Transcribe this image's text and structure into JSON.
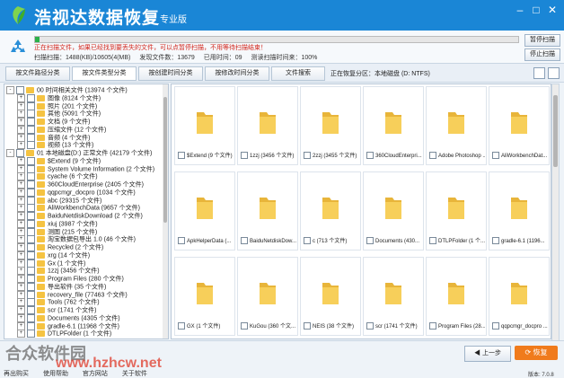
{
  "app": {
    "title": "浩视达数据恢复",
    "edition": "专业版",
    "colors": {
      "titlebar": "#1a86d6",
      "progress": "#2bb14a",
      "status_text": "#d2261c",
      "recover_button": "#f07b1c",
      "folder": "#f5c342"
    }
  },
  "window_controls": {
    "icons": [
      "minimize-icon",
      "maximize-icon",
      "close-icon"
    ]
  },
  "scan": {
    "progress": 0.01,
    "status": "正在扫描文件，如果已经找到要丢失的文件，可以点暂停扫描，不用等待扫描结束！",
    "stats": {
      "scanned": "扫描扫描：1488(KB)/10605(4(MB)",
      "found": "发现文件数：13679",
      "elapsed": "已用时间：09",
      "remaining": "测读扫描时间来：100%"
    },
    "pause_label": "暂停扫描",
    "stop_label": "停止扫描"
  },
  "tabs": [
    "按文件路径分类",
    "按文件类型分类",
    "按创建时间分类",
    "按修改时间分类",
    "文件搜索"
  ],
  "partition_label": "正在恢复分区：本地磁盘 (D: NTFS)",
  "tree": [
    {
      "label": "00 时间相关文件  (13974 个文件)",
      "level": 0,
      "expander": "-"
    },
    {
      "label": "图像  (8124 个文件)",
      "level": 1,
      "expander": "+"
    },
    {
      "label": "照片  (201 个文件)",
      "level": 1,
      "expander": "+"
    },
    {
      "label": "其他  (5091 个文件)",
      "level": 1,
      "expander": "+"
    },
    {
      "label": "文档  (9 个文件)",
      "level": 1,
      "expander": "+"
    },
    {
      "label": "压缩文件  (12 个文件)",
      "level": 1,
      "expander": "+"
    },
    {
      "label": "音频  (4 个文件)",
      "level": 1,
      "expander": "+"
    },
    {
      "label": "视频  (13 个文件)",
      "level": 1,
      "expander": "+"
    },
    {
      "label": "01 本地磁盘(D:) 正常文件  (42179 个文件)",
      "level": 0,
      "expander": "-"
    },
    {
      "label": "$Extend  (9 个文件)",
      "level": 1,
      "expander": "+"
    },
    {
      "label": "System Volume Information  (2 个文件)",
      "level": 1,
      "expander": "+"
    },
    {
      "label": "cyache  (6 个文件)",
      "level": 1,
      "expander": "+"
    },
    {
      "label": "360CloudEnterprise  (2405 个文件)",
      "level": 1,
      "expander": "+"
    },
    {
      "label": "qqpcmgr_docpro  (1034 个文件)",
      "level": 1,
      "expander": "+"
    },
    {
      "label": "abc  (29315 个文件)",
      "level": 1,
      "expander": "+"
    },
    {
      "label": "AliWorkbenchData  (9657 个文件)",
      "level": 1,
      "expander": "+"
    },
    {
      "label": "BaiduNetdiskDownload  (2 个文件)",
      "level": 1,
      "expander": "+"
    },
    {
      "label": "xiuj  (3987 个文件)",
      "level": 1,
      "expander": "+"
    },
    {
      "label": "测图  (215 个文件)",
      "level": 1,
      "expander": "+"
    },
    {
      "label": "淘宝数据包导出 1.0  (46 个文件)",
      "level": 1,
      "expander": "+"
    },
    {
      "label": "Recycled  (2 个文件)",
      "level": 1,
      "expander": "+"
    },
    {
      "label": "xrg  (14 个文件)",
      "level": 1,
      "expander": "+"
    },
    {
      "label": "Gx  (1 个文件)",
      "level": 1,
      "expander": "+"
    },
    {
      "label": "1zzj  (3456 个文件)",
      "level": 1,
      "expander": "+"
    },
    {
      "label": "Program Files  (280 个文件)",
      "level": 1,
      "expander": "+"
    },
    {
      "label": "导出软件  (35 个文件)",
      "level": 1,
      "expander": "+"
    },
    {
      "label": "recovery_file  (77463 个文件)",
      "level": 1,
      "expander": "+"
    },
    {
      "label": "Tools  (762 个文件)",
      "level": 1,
      "expander": "+"
    },
    {
      "label": "scr  (1741 个文件)",
      "level": 1,
      "expander": "+"
    },
    {
      "label": "Documents  (4305 个文件)",
      "level": 1,
      "expander": "+"
    },
    {
      "label": "gradle-6.1  (11968 个文件)",
      "level": 1,
      "expander": "+"
    },
    {
      "label": "DTLPFolder  (1 个文件)",
      "level": 1,
      "expander": "+"
    }
  ],
  "tiles": [
    "$Extend (9 个文件)",
    "1zzj (3456 个文件)",
    "2zzj (3455 个文件)",
    "360CloudEnterpri...",
    "Adobe Photoshop ...",
    "AliWorkbenchDat...",
    "ApkHelperData (...",
    "BaiduNetdiskDow...",
    "c (713 个文件)",
    "Documents (430...",
    "DTLPFolder (1 个...",
    "gradle-6.1 (1196...",
    "GX (1 个文件)",
    "KuGou (360 个文...",
    "NEIS (38 个文件)",
    "scr (1741 个文件)",
    "Program Files (28...",
    "qqpcmgr_docpro ..."
  ],
  "footer": {
    "prev_label": "上一步",
    "recover_label": "恢复",
    "links": [
      "再出购买",
      "使用帮助",
      "官方网站",
      "关于软件"
    ],
    "version": "版本: 7.0.8"
  },
  "watermark": {
    "line1": "合众软件园",
    "line2": "www.hzhcw.net"
  }
}
